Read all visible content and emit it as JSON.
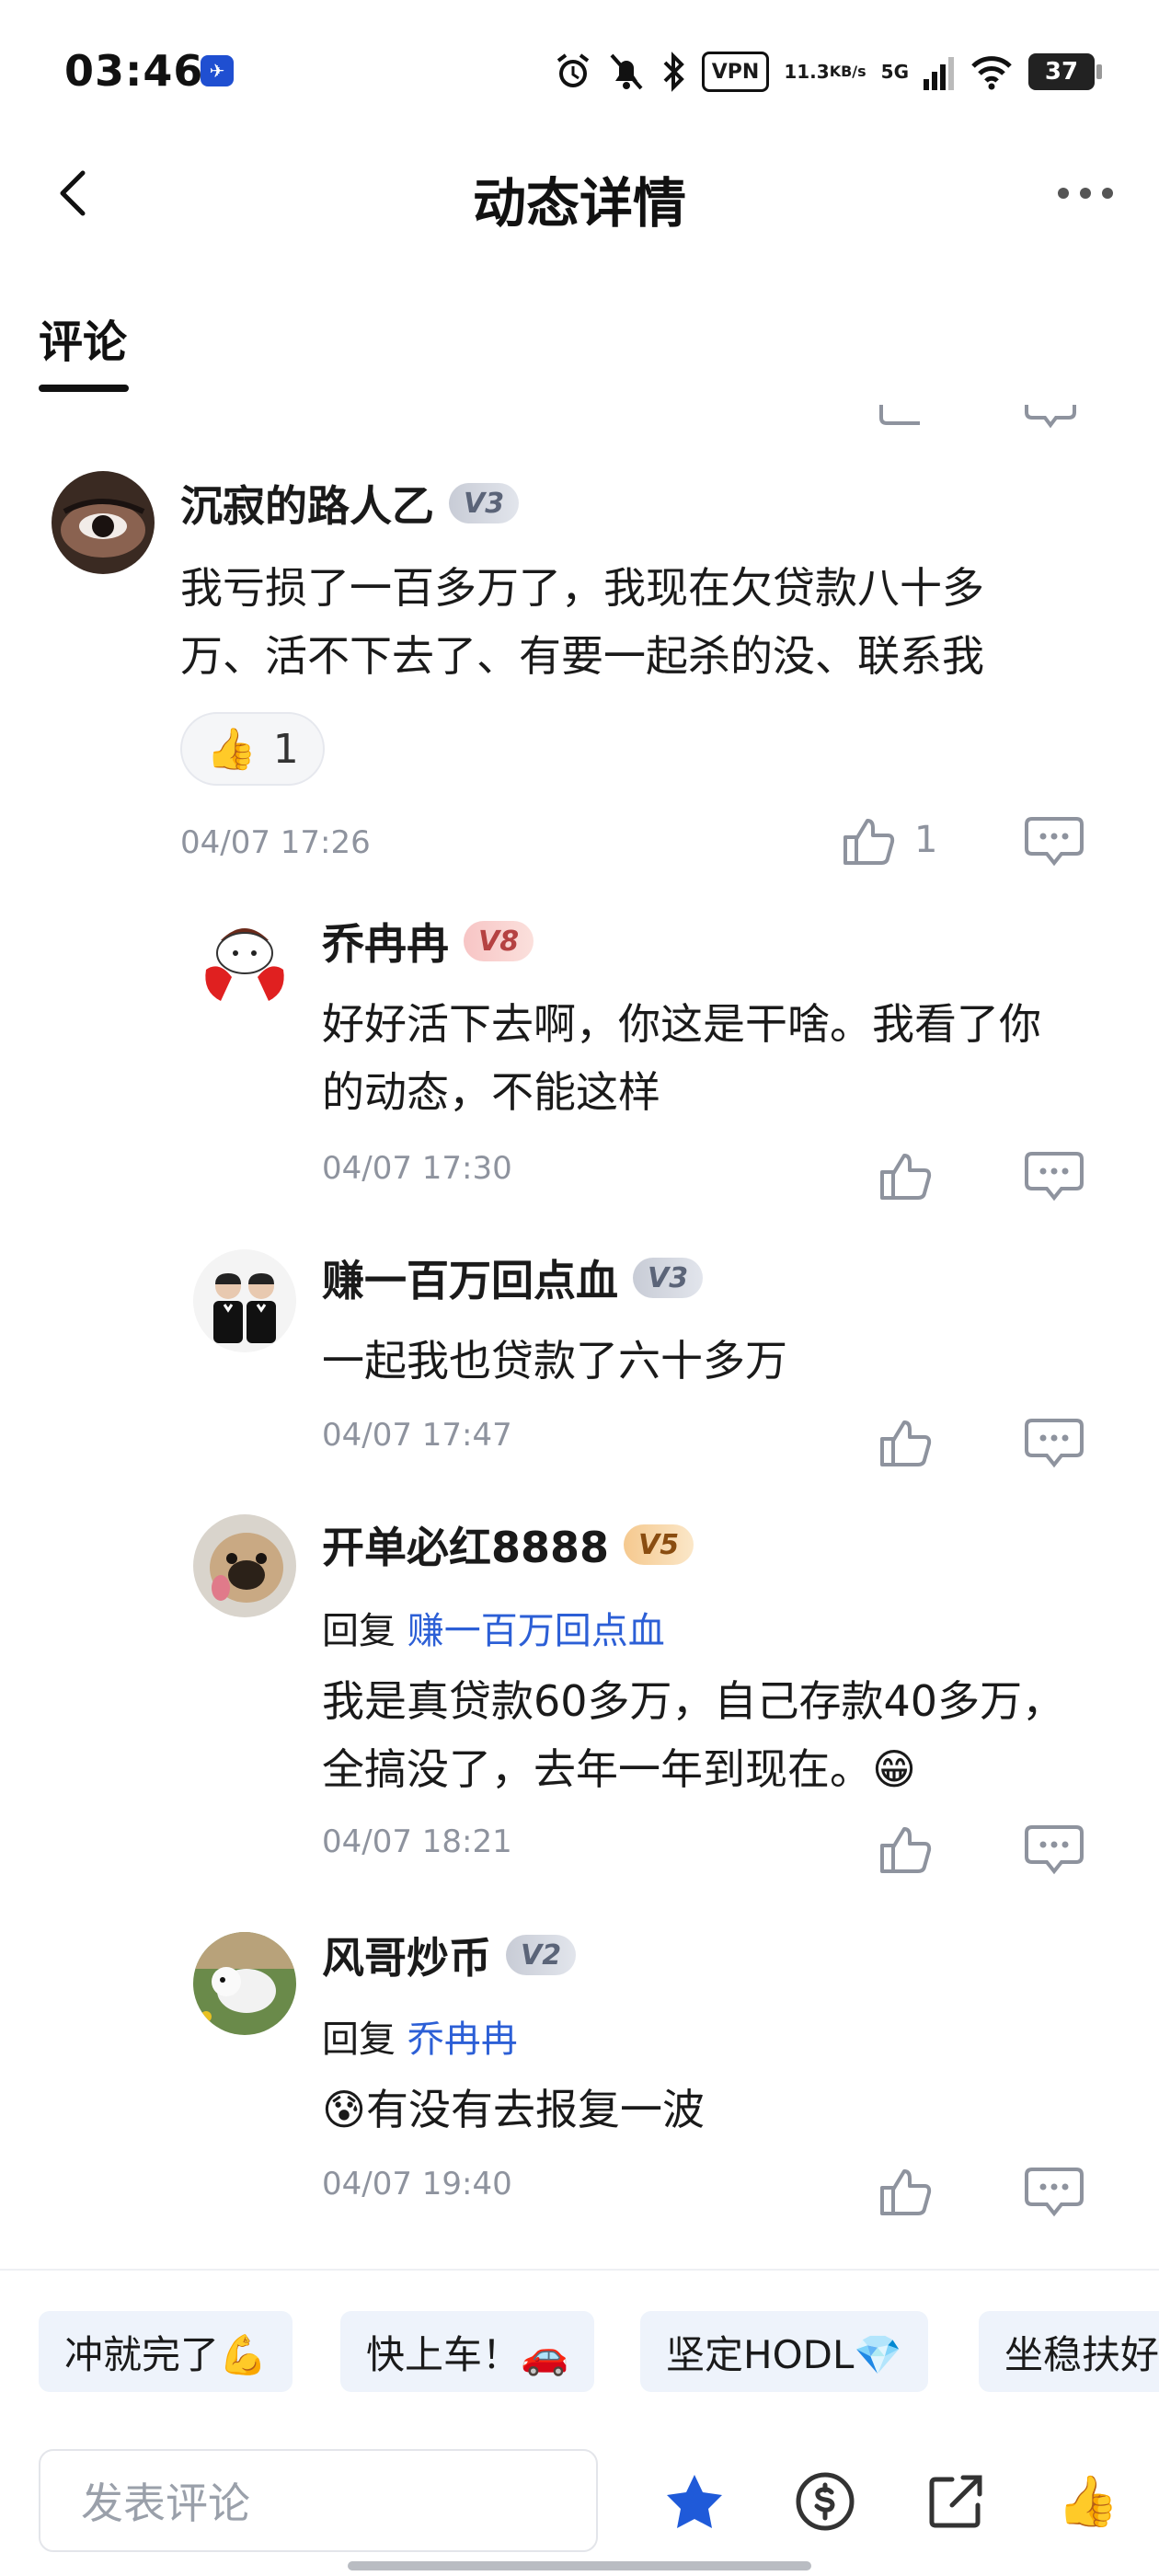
{
  "status_bar": {
    "time": "03:46",
    "vpn": "VPN",
    "net_speed_value": "11.3",
    "net_speed_unit": "KB/s",
    "network": "5G",
    "battery": "37"
  },
  "header": {
    "title": "动态详情"
  },
  "tabs": [
    {
      "label": "评论",
      "active": true
    }
  ],
  "comments": [
    {
      "username": "沉寂的路人乙",
      "level": "V3",
      "text_line1": "我亏损了一百多万了，我现在欠贷款八十多",
      "text_line2": "万、活不下去了、有要一起杀的没、联系我",
      "reaction_count": "1",
      "time": "04/07 17:26",
      "like_count": "1"
    },
    {
      "username": "乔冉冉",
      "level": "V8",
      "text_line1": "好好活下去啊，你这是干啥。我看了你",
      "text_line2": "的动态，不能这样",
      "time": "04/07 17:30"
    },
    {
      "username": "赚一百万回点血",
      "level": "V3",
      "text_line1": "一起我也贷款了六十多万",
      "time": "04/07 17:47"
    },
    {
      "username": "开单必红8888",
      "level": "V5",
      "reply_prefix": "回复",
      "reply_to": "赚一百万回点血",
      "text_line1": "我是真贷款60多万，自己存款40多万，",
      "text_line2": "全搞没了，去年一年到现在。😁",
      "time": "04/07 18:21"
    },
    {
      "username": "风哥炒币",
      "level": "V2",
      "reply_prefix": "回复",
      "reply_to": "乔冉冉",
      "text_line1": "😰有没有去报复一波",
      "time": "04/07 19:40"
    }
  ],
  "quick_replies": [
    "冲就完了💪",
    "快上车！🚗",
    "坚定HODL💎",
    "坐稳扶好"
  ],
  "bottom_bar": {
    "input_placeholder": "发表评论",
    "icons": [
      "star-icon",
      "coin-icon",
      "share-icon",
      "thumbs-up-emoji-icon"
    ]
  },
  "colors": {
    "accent_blue": "#1f5ad9",
    "link_blue": "#2c5fd6",
    "muted_gray": "#8e939e"
  }
}
